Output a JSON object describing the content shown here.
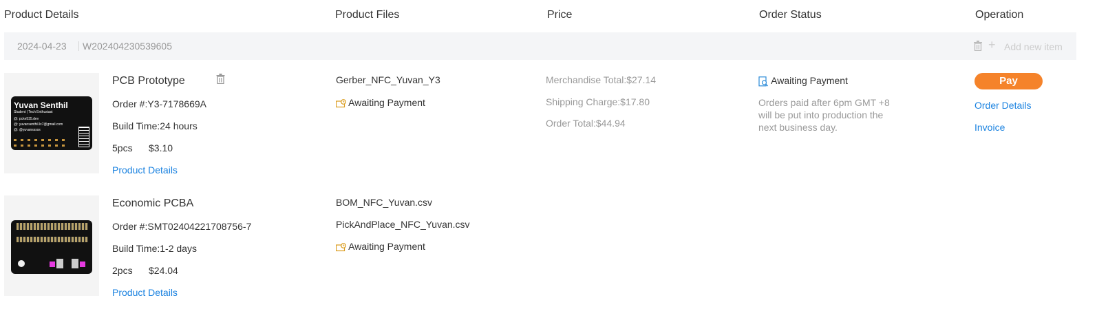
{
  "header": {
    "product_details": "Product Details",
    "product_files": "Product Files",
    "price": "Price",
    "order_status": "Order Status",
    "operation": "Operation"
  },
  "order": {
    "date": "2024-04-23",
    "number": "W202404230539605",
    "add_new_item": "Add new item"
  },
  "items": [
    {
      "name": "PCB Prototype",
      "order_no": "Order #:Y3-7178669A",
      "build_time": "Build Time:24 hours",
      "qty": "5pcs",
      "price": "$3.10",
      "details_link": "Product Details",
      "files": [
        "Gerber_NFC_Yuvan_Y3"
      ],
      "file_status": "Awaiting Payment",
      "thumb_text": {
        "name": "Yuvan Senthil",
        "subtitle": "Student | Tech Enthusiast",
        "line1": "@: pcke535.dev",
        "line2": "@: yuvansenthil.lx7@gmail.com",
        "line3": "@: @yuvansssss"
      }
    },
    {
      "name": "Economic PCBA",
      "order_no": "Order #:SMT02404221708756-7",
      "build_time": "Build Time:1-2 days",
      "qty": "2pcs",
      "price": "$24.04",
      "details_link": "Product Details",
      "files": [
        "BOM_NFC_Yuvan.csv",
        "PickAndPlace_NFC_Yuvan.csv"
      ],
      "file_status": "Awaiting Payment"
    }
  ],
  "price": {
    "merchandise": "Merchandise Total:$27.14",
    "shipping": "Shipping Charge:$17.80",
    "total": "Order Total:$44.94"
  },
  "status": {
    "label": "Awaiting Payment",
    "note": "Orders paid after 6pm GMT +8 will be put into production the next business day."
  },
  "operation": {
    "pay": "Pay",
    "order_details": "Order Details",
    "invoice": "Invoice"
  },
  "colors": {
    "accent": "#f5832a",
    "link": "#1a82e0",
    "muted": "#999999"
  }
}
